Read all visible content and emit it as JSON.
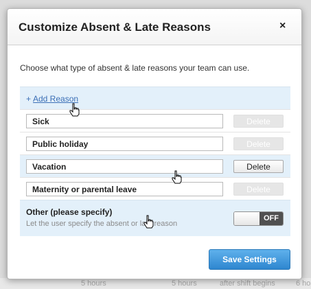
{
  "dialog": {
    "title": "Customize Absent & Late Reasons",
    "close_label": "×",
    "description": "Choose what type of absent & late reasons your team can use.",
    "add_plus": "+",
    "add_reason_label": "Add Reason",
    "delete_label": "Delete",
    "reasons": [
      {
        "label": "Sick",
        "delete_enabled": false
      },
      {
        "label": "Public holiday",
        "delete_enabled": false
      },
      {
        "label": "Vacation",
        "delete_enabled": true
      },
      {
        "label": "Maternity or parental leave",
        "delete_enabled": false
      }
    ],
    "other": {
      "title": "Other (please specify)",
      "subtitle": "Let the user specify the absent or late reason",
      "toggle_state": "OFF"
    },
    "save_label": "Save Settings"
  },
  "background": {
    "bottom_cells": [
      "5 hours",
      "5 hours",
      "after shift begins",
      "6 ho"
    ]
  },
  "colors": {
    "accent": "#3b6fb6",
    "highlight_row": "#e3f0fa",
    "save_button": "#3d95dc",
    "toggle_off": "#505050"
  }
}
